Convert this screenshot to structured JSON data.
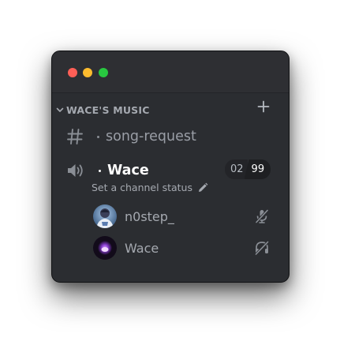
{
  "window": {
    "traffic_lights": [
      "close",
      "minimize",
      "maximize"
    ]
  },
  "category": {
    "label": "WACE'S MUSIC",
    "icon": "chevron-down-icon",
    "add_icon": "plus-icon"
  },
  "text_channel": {
    "name": "song-request",
    "icon": "hash-icon"
  },
  "voice_channel": {
    "name": "Wace",
    "icon": "speaker-icon",
    "user_count": "02",
    "user_limit": "99",
    "status_placeholder": "Set a channel status",
    "status_icon": "pencil-icon"
  },
  "voice_users": [
    {
      "name": "n0step_",
      "icon": "microphone-muted-icon"
    },
    {
      "name": "Wace",
      "icon": "headphones-deafened-icon"
    }
  ],
  "colors": {
    "background": "#2b2d31",
    "titlebar": "#2e2f33",
    "muted_text": "#a5a9b0",
    "active_text": "#ffffff",
    "red_light": "#ff5f57",
    "yellow_light": "#febc2e",
    "green_light": "#28c840"
  }
}
